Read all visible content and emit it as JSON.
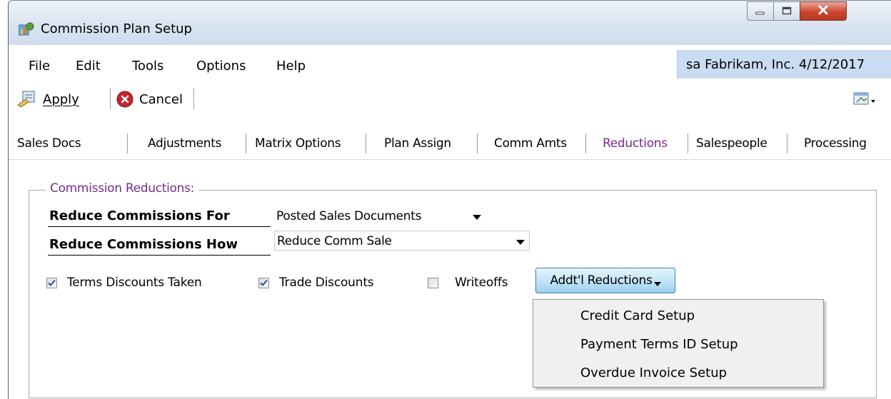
{
  "window": {
    "title": "Commission Plan Setup",
    "icon": "commission-plan-icon",
    "controls": [
      "minimize-icon",
      "maximize-icon",
      "close-icon"
    ]
  },
  "menu": {
    "items": [
      "File",
      "Edit",
      "Tools",
      "Options",
      "Help"
    ],
    "status": "sa  Fabrikam, Inc. 4/12/2017"
  },
  "toolbar": {
    "apply_label": "Apply",
    "cancel_label": "Cancel",
    "right_icon": "window-options-icon"
  },
  "tabs": [
    {
      "label": "Sales Docs",
      "active": false
    },
    {
      "label": "Adjustments",
      "active": false
    },
    {
      "label": "Matrix Options",
      "active": false
    },
    {
      "label": "Plan Assign",
      "active": false
    },
    {
      "label": "Comm Amts",
      "active": false
    },
    {
      "label": "Reductions",
      "active": true
    },
    {
      "label": "Salespeople",
      "active": false
    },
    {
      "label": "Processing",
      "active": false
    }
  ],
  "reductions": {
    "group_label": "Commission Reductions:",
    "reduce_for_label": "Reduce Commissions For",
    "reduce_for_value": "Posted Sales Documents",
    "reduce_how_label": "Reduce Commissions How",
    "reduce_how_value": "Reduce Comm Sale",
    "checkboxes": [
      {
        "label": "Terms Discounts Taken",
        "checked": true
      },
      {
        "label": "Trade Discounts",
        "checked": true
      },
      {
        "label": "Writeoffs",
        "checked": false
      }
    ],
    "addtl_button_label": "Addt'l Reductions"
  },
  "popup_menu": {
    "items": [
      "Credit Card Setup",
      "Payment Terms ID Setup",
      "Overdue Invoice Setup"
    ]
  },
  "colors": {
    "active_tab": "#7a2b8c",
    "status_bg": "#c9dcf2",
    "checkmark": "#2a4f9e"
  }
}
